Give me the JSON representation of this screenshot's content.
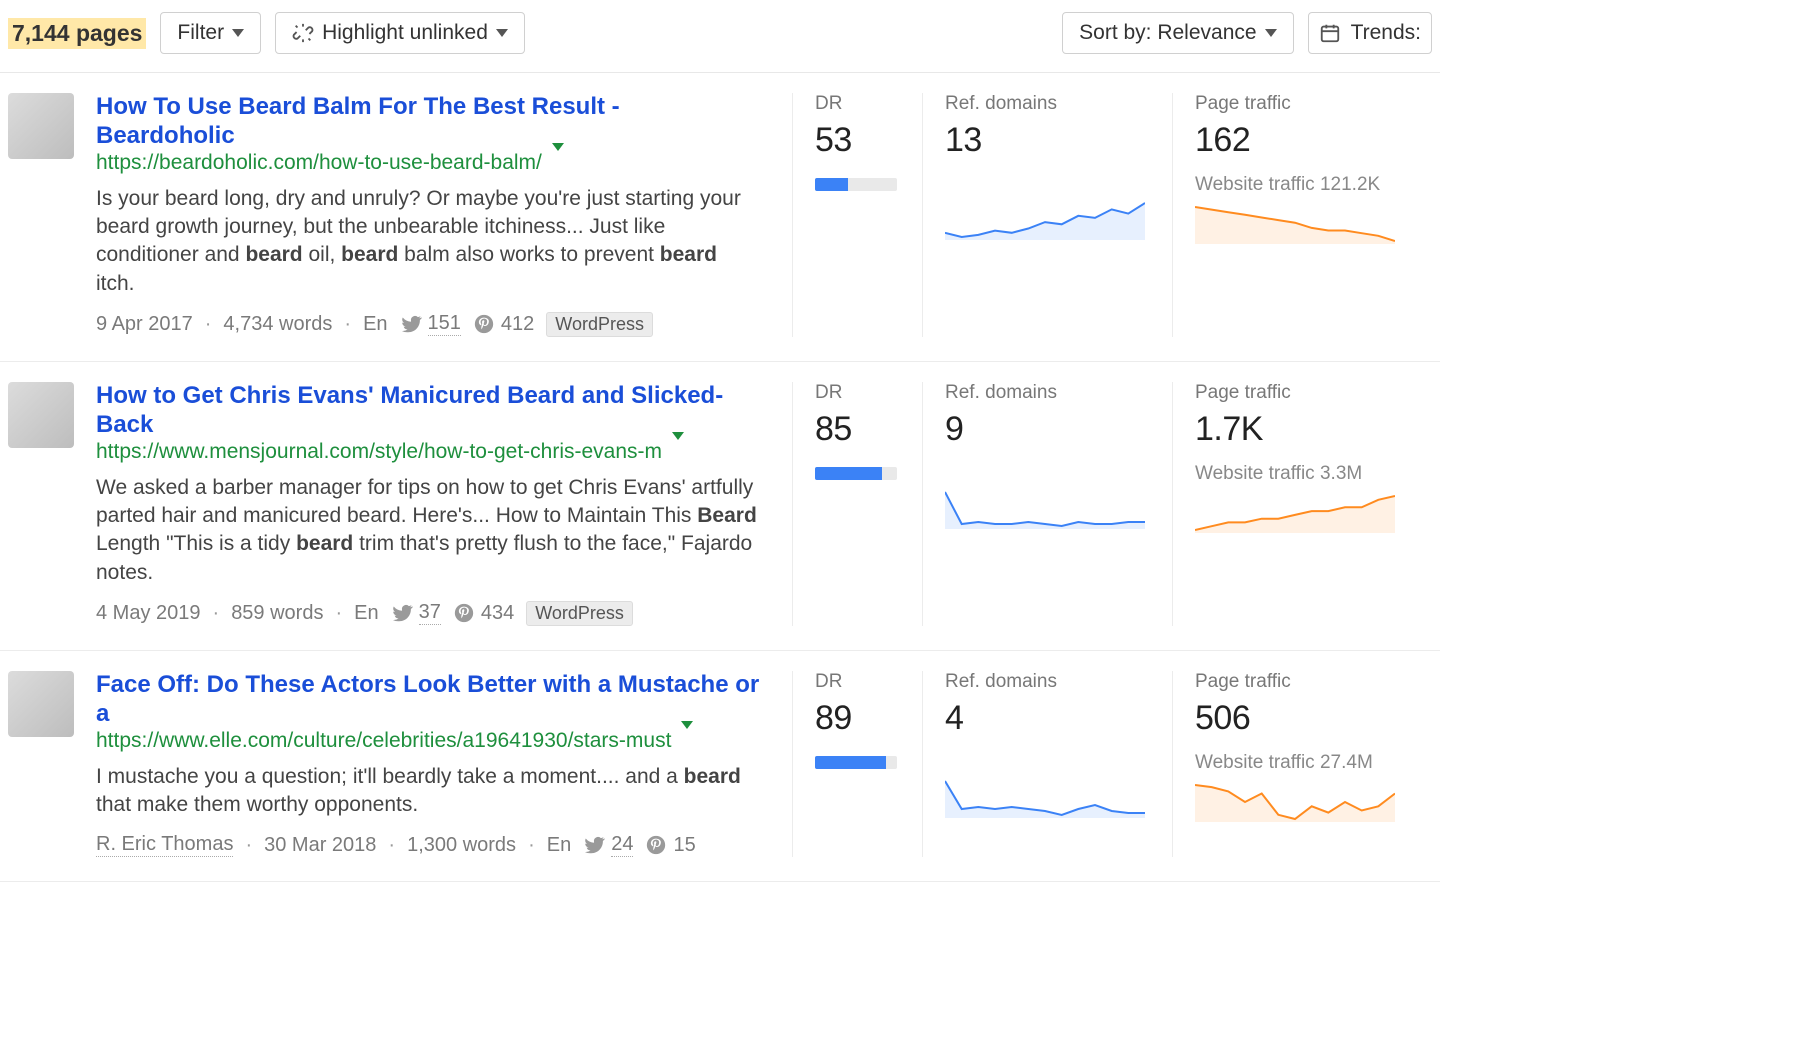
{
  "toolbar": {
    "page_count": "7,144 pages",
    "filter_label": "Filter",
    "highlight_label": "Highlight unlinked",
    "sort_label": "Sort by: Relevance",
    "trends_label": "Trends:"
  },
  "labels": {
    "dr": "DR",
    "ref_domains": "Ref. domains",
    "page_traffic": "Page traffic",
    "website_traffic_prefix": "Website traffic "
  },
  "results": [
    {
      "title": "How To Use Beard Balm For The Best Result - Beardoholic",
      "url": "https://beardoholic.com/how-to-use-beard-balm/",
      "snippet_html": "Is your beard long, dry and unruly? Or maybe you're just starting your beard growth journey, but the unbearable itchiness... Just like conditioner and <b>beard</b> oil, <b>beard</b> balm also works to prevent <b>beard</b> itch.",
      "author": "",
      "date": "9 Apr 2017",
      "words": "4,734 words",
      "lang": "En",
      "twitter": "151",
      "pinterest": "412",
      "platform": "WordPress",
      "dr": "53",
      "dr_pct": 40,
      "ref_domains": "13",
      "page_traffic": "162",
      "website_traffic": "121.2K",
      "ref_spark": [
        22,
        20,
        21,
        23,
        22,
        24,
        27,
        26,
        30,
        29,
        33,
        31,
        36
      ],
      "traffic_spark": [
        32,
        31,
        30,
        29,
        28,
        27,
        26,
        24,
        23,
        23,
        22,
        21,
        19
      ]
    },
    {
      "title": "How to Get Chris Evans' Manicured Beard and Slicked-Back",
      "url": "https://www.mensjournal.com/style/how-to-get-chris-evans-m",
      "snippet_html": "We asked a barber manager for tips on how to get Chris Evans' artfully parted hair and manicured beard. Here's... How to Maintain This <b>Beard</b> Length \"This is a tidy <b>beard</b> trim that's pretty flush to the face,\" Fajardo notes.",
      "author": "",
      "date": "4 May 2019",
      "words": "859 words",
      "lang": "En",
      "twitter": "37",
      "pinterest": "434",
      "platform": "WordPress",
      "dr": "85",
      "dr_pct": 82,
      "ref_domains": "9",
      "page_traffic": "1.7K",
      "website_traffic": "3.3M",
      "ref_spark": [
        30,
        14,
        15,
        14,
        14,
        15,
        14,
        13,
        15,
        14,
        14,
        15,
        15
      ],
      "traffic_spark": [
        19,
        20,
        21,
        21,
        22,
        22,
        23,
        24,
        24,
        25,
        25,
        27,
        28
      ]
    },
    {
      "title": "Face Off: Do These Actors Look Better with a Mustache or a",
      "url": "https://www.elle.com/culture/celebrities/a19641930/stars-must",
      "snippet_html": "I mustache you a question; it'll beardly take a moment.... and a <b>beard</b> that make them worthy opponents.",
      "author": "R. Eric Thomas",
      "date": "30 Mar 2018",
      "words": "1,300 words",
      "lang": "En",
      "twitter": "24",
      "pinterest": "15",
      "platform": "",
      "dr": "89",
      "dr_pct": 86,
      "ref_domains": "4",
      "page_traffic": "506",
      "website_traffic": "27.4M",
      "ref_spark": [
        30,
        16,
        17,
        16,
        17,
        16,
        15,
        13,
        16,
        18,
        15,
        14,
        14
      ],
      "traffic_spark": [
        30,
        29,
        27,
        22,
        26,
        16,
        14,
        20,
        17,
        22,
        18,
        20,
        26
      ]
    }
  ]
}
